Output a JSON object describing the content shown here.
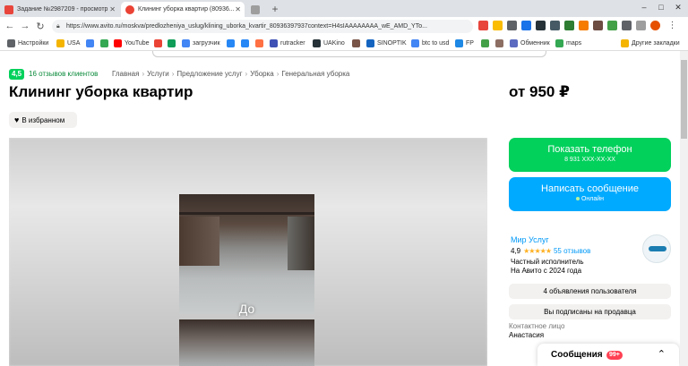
{
  "browser": {
    "tabs": [
      {
        "label": "Задание №2987209 - просмотр",
        "favicon_color": "#e8453c"
      },
      {
        "label": "Клининг уборка квартир (80936...",
        "favicon_color": "#ea4335"
      },
      {
        "label": "",
        "favicon_color": "#9e9e9e"
      }
    ],
    "new_tab": "+",
    "url": "https://www.avito.ru/moskva/predlozheniya_uslug/klining_uborka_kvartir_80936397937context=H4sIAAAAAAAA_wE_AMD_YTo...",
    "win_controls": [
      "–",
      "□",
      "✕"
    ],
    "nav": {
      "back": "←",
      "forward": "→",
      "reload": "↻"
    },
    "bookmarks": [
      {
        "label": "Настройки",
        "color": "#5f6368"
      },
      {
        "label": "USA",
        "color": "#f4b400"
      },
      {
        "label": "",
        "color": "#4285f4"
      },
      {
        "label": "",
        "color": "#34a853"
      },
      {
        "label": "YouTube",
        "color": "#ff0000"
      },
      {
        "label": "",
        "color": "#ea4335"
      },
      {
        "label": "",
        "color": "#0f9d58"
      },
      {
        "label": "загрузчик",
        "color": "#4285f4"
      },
      {
        "label": "",
        "color": "#2787f5"
      },
      {
        "label": "",
        "color": "#2787f5"
      },
      {
        "label": "",
        "color": "#ff7043"
      },
      {
        "label": "rutracker",
        "color": "#3f51b5"
      },
      {
        "label": "UAKino",
        "color": "#263238"
      },
      {
        "label": "",
        "color": "#795548"
      },
      {
        "label": "SINOPTIK",
        "color": "#1565c0"
      },
      {
        "label": "btc to usd",
        "color": "#4285f4"
      },
      {
        "label": "FP",
        "color": "#1e88e5"
      },
      {
        "label": "",
        "color": "#43a047"
      },
      {
        "label": "",
        "color": "#8d6e63"
      },
      {
        "label": "Обменник",
        "color": "#5c6bc0"
      },
      {
        "label": "maps",
        "color": "#34a853"
      },
      {
        "label": "Другие закладки",
        "color": "#f4b400"
      }
    ]
  },
  "page": {
    "rating": "4,5",
    "reviews_link": "16 отзывов клиентов",
    "breadcrumb": [
      "Главная",
      "Услуги",
      "Предложение услуг",
      "Уборка",
      "Генеральная уборка"
    ],
    "breadcrumb_sep": "›",
    "title": "Клининг уборка квартир",
    "price": "от 950 ₽",
    "favorite_label": "В избранном",
    "photo_label": "До",
    "phone_button": {
      "label": "Показать телефон",
      "number": "8 931 XXX-XX-XX"
    },
    "message_button": {
      "label": "Написать сообщение",
      "status": "Онлайн"
    },
    "seller": {
      "name": "Мир Услуг",
      "rating": "4,9",
      "stars": "★★★★★",
      "reviews": "55 отзывов",
      "type": "Частный исполнитель",
      "since": "На Авито с 2024 года"
    },
    "ads_button": "4 объявления пользователя",
    "subscribed_button": "Вы подписаны на продавца",
    "contact_label": "Контактное лицо",
    "contact_name": "Анастасия",
    "messages_panel": {
      "label": "Сообщения",
      "badge": "99+",
      "chevron": "⌃"
    }
  },
  "colors": {
    "green": "#02d15c",
    "blue": "#00aaff",
    "link_blue": "#0099f7",
    "star": "#ffb021",
    "badge_red": "#ff4053"
  }
}
